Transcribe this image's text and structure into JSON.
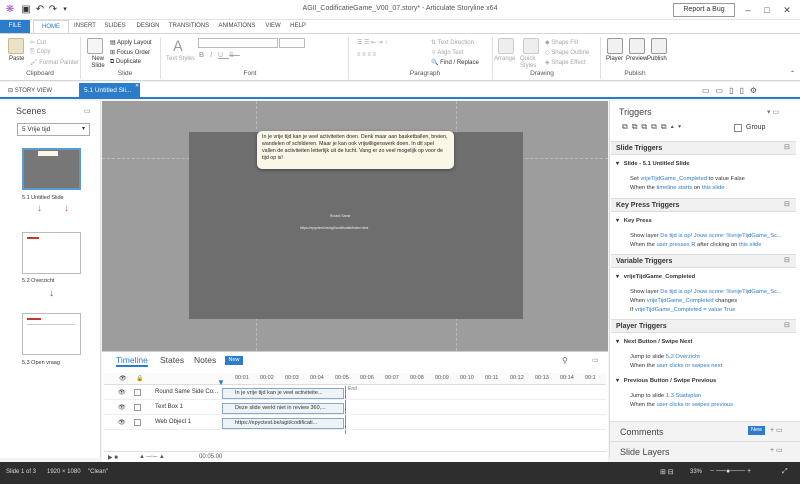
{
  "window": {
    "title": "AGII_CodificatieGame_V00_07.story* - Articulate Storyline x64",
    "report_bug": "Report a Bug"
  },
  "menu": {
    "tabs": [
      "FILE",
      "HOME",
      "INSERT",
      "SLIDES",
      "DESIGN",
      "TRANSITIONS",
      "ANIMATIONS",
      "VIEW",
      "HELP"
    ]
  },
  "ribbon": {
    "clipboard": {
      "paste": "Paste",
      "cut": "Cut",
      "copy": "Copy",
      "format_painter": "Format Painter",
      "label": "Clipboard"
    },
    "slide": {
      "new_slide": "New Slide",
      "apply_layout": "Apply Layout",
      "focus_order": "Focus Order",
      "duplicate": "Duplicate",
      "label": "Slide"
    },
    "font": {
      "text_styles": "Text Styles",
      "bold": "B",
      "italic": "I",
      "underline": "U",
      "strike": "S",
      "label": "Font"
    },
    "paragraph": {
      "text_direction": "Text Direction",
      "align_text": "Align Text",
      "find_replace": "Find / Replace",
      "label": "Paragraph"
    },
    "drawing": {
      "arrange": "Arrange",
      "quick_styles": "Quick Styles",
      "shape_fill": "Shape Fill",
      "shape_outline": "Shape Outline",
      "shape_effect": "Shape Effect",
      "label": "Drawing"
    },
    "publish": {
      "player": "Player",
      "preview": "Preview",
      "publish": "Publish",
      "label": "Publish"
    }
  },
  "doc_tabs": {
    "story_view": "STORY VIEW",
    "slide": "5.1 Untitled Sli..."
  },
  "scenes": {
    "title": "Scenes",
    "dropdown": "5 Vrije tijd",
    "slides": [
      "5.1 Untitled Slide",
      "5.2 Overzicht",
      "5.3 Open vraag"
    ]
  },
  "stage": {
    "tooltip": "In je vrije tijd kan je veel activiteiten doen. Denk maar aan basketballen, breien, wandelen of schilderen. Maar je kan ook vrijwilligerswerk doen. In dit spel vallen de activiteiten letterlijk uit de lucht. Vang er zo veel mogelijk op voor de tijd op is!",
    "center_title": "Round Same",
    "center_url": "https://epyctest.be/agii/codificatie/index.html"
  },
  "timeline": {
    "tabs": [
      "Timeline",
      "States",
      "Notes"
    ],
    "new_badge": "New",
    "ticks": [
      "00:01",
      "00:02",
      "00:03",
      "00:04",
      "00:05",
      "00:06",
      "00:07",
      "00:08",
      "00:09",
      "00:10",
      "00:11",
      "00:12",
      "00:13",
      "00:14",
      "00:1"
    ],
    "end_label": "End",
    "rows": [
      {
        "name": "Round Same Side Co...",
        "bar": "In je vrije tijd kan je veel activiteite..."
      },
      {
        "name": "Text Box 1",
        "bar": "Deze slide werkt niet in review 360,..."
      },
      {
        "name": "Web Object 1",
        "bar": "https://epyctest.be/agii/codificati..."
      }
    ],
    "time": "00:05.00"
  },
  "triggers": {
    "title": "Triggers",
    "group": "Group",
    "sections": [
      {
        "header": "Slide Triggers",
        "sub": "Slide - 5.1 Untitled Slide",
        "lines": [
          [
            "Set ",
            "vrijeTijdGame_Completed",
            " to value False"
          ],
          [
            "When the ",
            "timeline starts",
            " on ",
            "this slide"
          ]
        ]
      },
      {
        "header": "Key Press Triggers",
        "sub": "Key Press",
        "lines": [
          [
            "Show layer ",
            "De tijd is op! Jouw score: %vrijeTijdGame_Sc...",
            "",
            ""
          ],
          [
            "When the ",
            "user presses R",
            " after clicking on ",
            "this slide"
          ]
        ]
      },
      {
        "header": "Variable Triggers",
        "sub": "vrijeTijdGame_Completed",
        "lines": [
          [
            "Show layer ",
            "De tijd is op! Jouw score: %vrijeTijdGame_Sc...",
            "",
            ""
          ],
          [
            "When ",
            "vrijeTijdGame_Completed",
            " changes",
            ""
          ],
          [
            "If ",
            "vrijeTijdGame_Completed = value True",
            "",
            ""
          ]
        ]
      },
      {
        "header": "Player Triggers",
        "sub": "Next Button / Swipe Next",
        "lines": [
          [
            "Jump to slide ",
            "5.2 Overzicht",
            "",
            ""
          ],
          [
            "When the ",
            "user clicks or swipes next",
            "",
            ""
          ]
        ]
      }
    ],
    "extra": {
      "sub": "Previous Button / Swipe Previous",
      "lines": [
        [
          "Jump to slide ",
          "1.3 Stadsplan",
          "",
          ""
        ],
        [
          "When the ",
          "user clicks or swipes previous",
          "",
          ""
        ]
      ]
    },
    "comments": "Comments",
    "comments_badge": "New",
    "slide_layers": "Slide Layers"
  },
  "status": {
    "slide": "Slide 1 of 3",
    "size": "1920 × 1080",
    "theme": "\"Clean\"",
    "zoom": "33%"
  }
}
